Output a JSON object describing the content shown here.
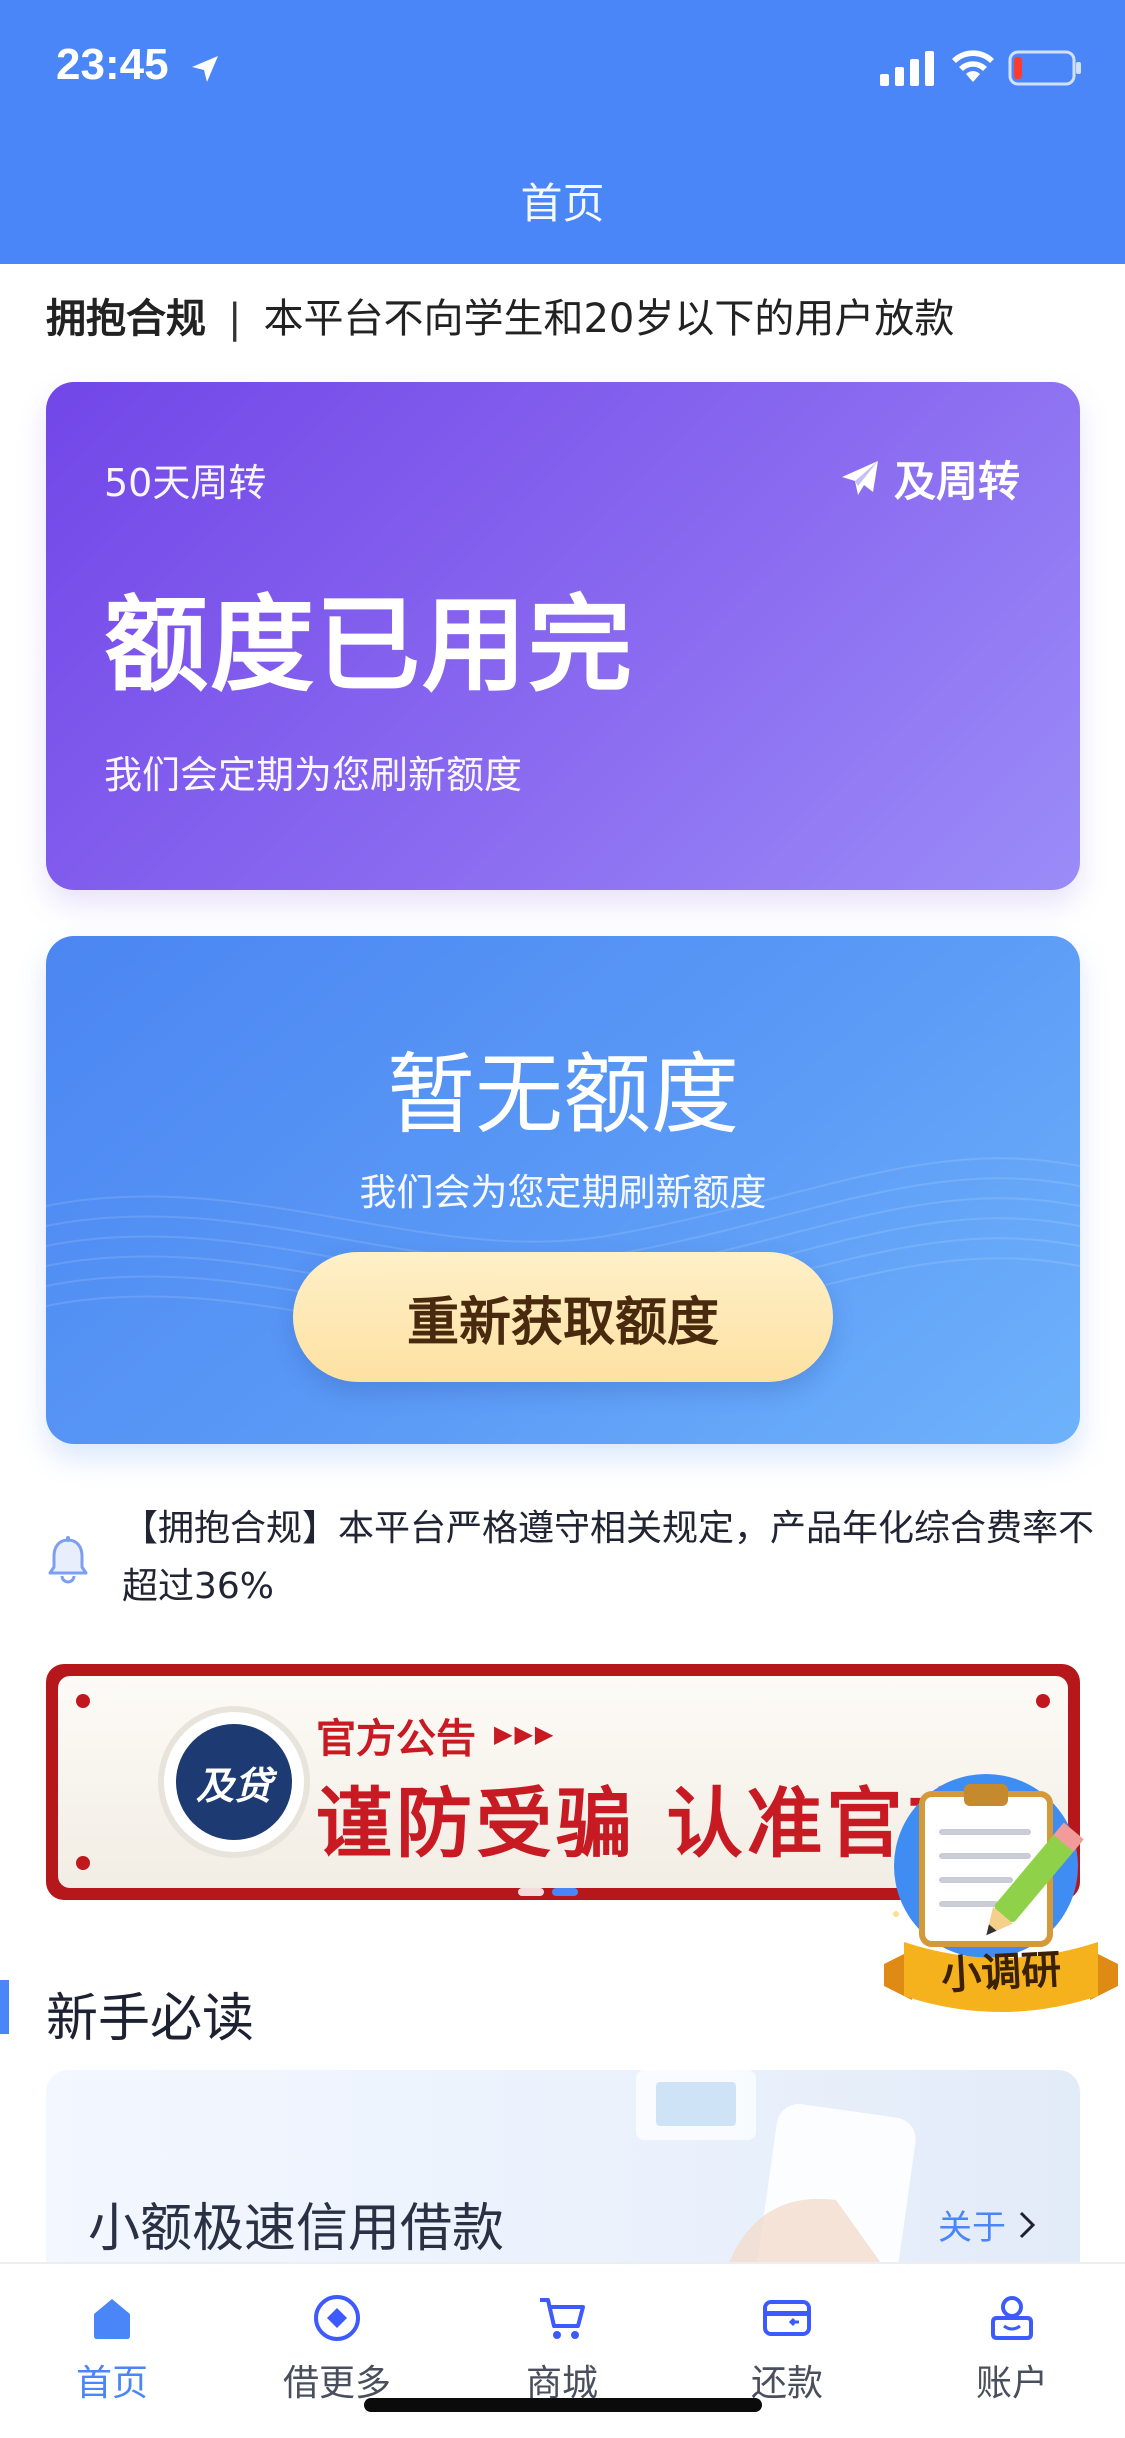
{
  "status_bar": {
    "time": "23:45"
  },
  "header": {
    "title": "首页"
  },
  "compliance": {
    "label": "拥抱合规",
    "separator": "|",
    "text": "本平台不向学生和20岁以下的用户放款"
  },
  "credit_card": {
    "cycle": "50天周转",
    "brand": "及周转",
    "status": "额度已用完",
    "subtitle": "我们会定期为您刷新额度"
  },
  "quota_card": {
    "title": "暂无额度",
    "subtitle": "我们会为您定期刷新额度",
    "button_label": "重新获取额度"
  },
  "notice": {
    "text": "【拥抱合规】本平台严格遵守相关规定，产品年化综合费率不超过36%"
  },
  "banner": {
    "logo_text": "及贷",
    "announcement": "官方公告",
    "announcement_arrows": "▶▶▶",
    "warning": "谨防受骗 认准官方",
    "pages": 2,
    "active_page": 2
  },
  "survey": {
    "label": "小调研"
  },
  "section": {
    "title": "新手必读"
  },
  "guide_card": {
    "title": "小额极速信用借款",
    "link_label": "关于"
  },
  "tabs": [
    {
      "label": "首页",
      "icon": "home-icon",
      "active": true
    },
    {
      "label": "借更多",
      "icon": "borrow-more-icon",
      "active": false
    },
    {
      "label": "商城",
      "icon": "cart-icon",
      "active": false
    },
    {
      "label": "还款",
      "icon": "repay-card-icon",
      "active": false
    },
    {
      "label": "账户",
      "icon": "account-icon",
      "active": false
    }
  ],
  "colors": {
    "primary": "#4a86f7",
    "purple_card": "#7b5cee",
    "banner_red": "#c81a22",
    "cta_bg": "#fde6ae"
  }
}
